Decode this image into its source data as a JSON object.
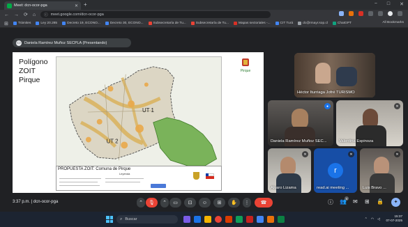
{
  "browser": {
    "tab_title": "Meet: dcn-ocor-pga",
    "new_tab": "+",
    "url": "meet.google.com/dcn-ocor-pga",
    "window_controls": [
      "−",
      "□",
      "✕"
    ],
    "bookmarks": [
      "Trámites",
      "Ley 20.285",
      "Decreto 19, ECONO...",
      "Decreto 30, ECONO...",
      "Subsecretaría de Tu...",
      "Subsecretaría de Tu...",
      "Mapas sectoriales -...",
      "CIT Turá",
      "dc@rmayr.sop.cl",
      "ChatGPT"
    ],
    "all_bookmarks": "All Bookmarks"
  },
  "meet": {
    "presenter_label": "Daniela Ramírez Muñoz SECPLA (Presentando)",
    "slide": {
      "title": "Polígono\nZOIT\nPirque",
      "logo_text": "Pirque",
      "map_labels": [
        "UT 1",
        "UT 2"
      ],
      "legend_title": "PROPUESTA ZOIT: Comuna de Pirque",
      "legend_sub": "Leyenda"
    },
    "participants": [
      {
        "name": "Héctor Iturriaga Jofré TURISMO",
        "muted": false
      },
      {
        "name": "Daniela Ramírez Muñoz SEC...",
        "muted": false
      },
      {
        "name": "Valentina Espinoza",
        "muted": true
      },
      {
        "name": "Alvaro Lizama",
        "muted": true
      },
      {
        "name": "read.ai meeting ...",
        "muted": true,
        "avatar_letter": "r"
      },
      {
        "name": "Luis Bravo ...",
        "muted": true
      }
    ],
    "meeting_time": "3:37 p.m.",
    "meeting_code": "dcn-ocor-pga",
    "participant_count": "9",
    "end_call_glyph": "☎"
  },
  "taskbar": {
    "search_placeholder": "Buscar",
    "time": "15:37",
    "date": "07-07-2025"
  },
  "colors": {
    "meet_bg": "#202124",
    "tile_bg": "#3c4043",
    "end_call": "#ea4335",
    "avatar_blue": "#1a73e8",
    "taskbar": "#1c2431"
  }
}
